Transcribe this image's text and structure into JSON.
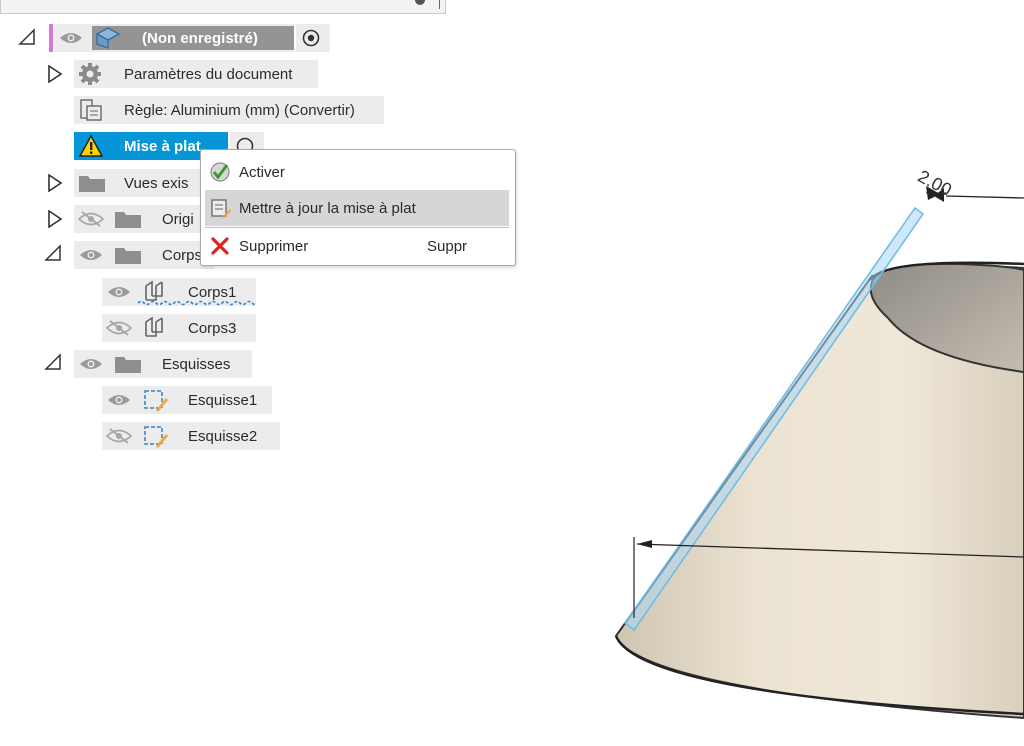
{
  "browser": {
    "root": {
      "label": "(Non enregistré)"
    },
    "items": [
      {
        "label": "Paramètres du document"
      },
      {
        "label": "Règle: Aluminium (mm) (Convertir)"
      },
      {
        "label": "Mise à plat"
      },
      {
        "label": "Vues exis"
      },
      {
        "label": "Origi"
      },
      {
        "label": "Corps"
      },
      {
        "label": "Corps1"
      },
      {
        "label": "Corps3"
      },
      {
        "label": "Esquisses"
      },
      {
        "label": "Esquisse1"
      },
      {
        "label": "Esquisse2"
      }
    ]
  },
  "context_menu": {
    "items": [
      {
        "label": "Activer",
        "shortcut": ""
      },
      {
        "label": "Mettre à jour la mise à plat",
        "shortcut": ""
      },
      {
        "label": "Supprimer",
        "shortcut": "Suppr"
      }
    ]
  },
  "viewport": {
    "dimension_label": "2.00"
  },
  "colors": {
    "selection": "#0696d7",
    "accent_pink": "#d977d9",
    "menu_hover": "#d6d6d6",
    "cone": "#e6dccb"
  }
}
